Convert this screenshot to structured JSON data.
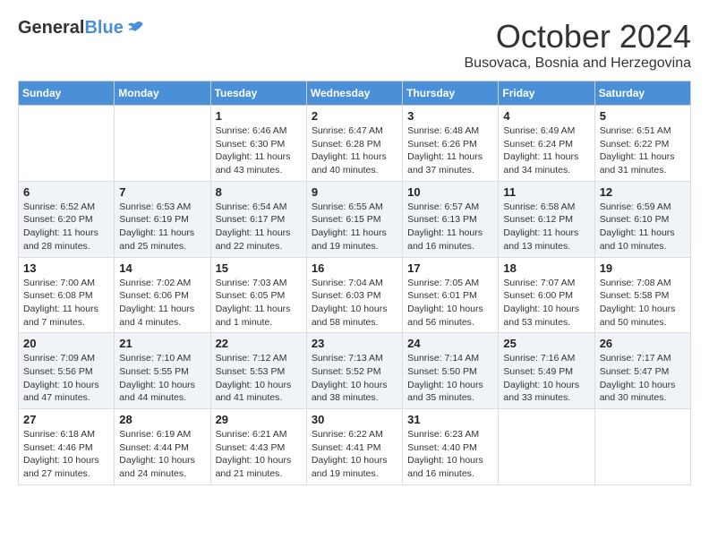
{
  "logo": {
    "general": "General",
    "blue": "Blue"
  },
  "header": {
    "month": "October 2024",
    "location": "Busovaca, Bosnia and Herzegovina"
  },
  "weekdays": [
    "Sunday",
    "Monday",
    "Tuesday",
    "Wednesday",
    "Thursday",
    "Friday",
    "Saturday"
  ],
  "weeks": [
    [
      {
        "day": "",
        "info": ""
      },
      {
        "day": "",
        "info": ""
      },
      {
        "day": "1",
        "info": "Sunrise: 6:46 AM\nSunset: 6:30 PM\nDaylight: 11 hours and 43 minutes."
      },
      {
        "day": "2",
        "info": "Sunrise: 6:47 AM\nSunset: 6:28 PM\nDaylight: 11 hours and 40 minutes."
      },
      {
        "day": "3",
        "info": "Sunrise: 6:48 AM\nSunset: 6:26 PM\nDaylight: 11 hours and 37 minutes."
      },
      {
        "day": "4",
        "info": "Sunrise: 6:49 AM\nSunset: 6:24 PM\nDaylight: 11 hours and 34 minutes."
      },
      {
        "day": "5",
        "info": "Sunrise: 6:51 AM\nSunset: 6:22 PM\nDaylight: 11 hours and 31 minutes."
      }
    ],
    [
      {
        "day": "6",
        "info": "Sunrise: 6:52 AM\nSunset: 6:20 PM\nDaylight: 11 hours and 28 minutes."
      },
      {
        "day": "7",
        "info": "Sunrise: 6:53 AM\nSunset: 6:19 PM\nDaylight: 11 hours and 25 minutes."
      },
      {
        "day": "8",
        "info": "Sunrise: 6:54 AM\nSunset: 6:17 PM\nDaylight: 11 hours and 22 minutes."
      },
      {
        "day": "9",
        "info": "Sunrise: 6:55 AM\nSunset: 6:15 PM\nDaylight: 11 hours and 19 minutes."
      },
      {
        "day": "10",
        "info": "Sunrise: 6:57 AM\nSunset: 6:13 PM\nDaylight: 11 hours and 16 minutes."
      },
      {
        "day": "11",
        "info": "Sunrise: 6:58 AM\nSunset: 6:12 PM\nDaylight: 11 hours and 13 minutes."
      },
      {
        "day": "12",
        "info": "Sunrise: 6:59 AM\nSunset: 6:10 PM\nDaylight: 11 hours and 10 minutes."
      }
    ],
    [
      {
        "day": "13",
        "info": "Sunrise: 7:00 AM\nSunset: 6:08 PM\nDaylight: 11 hours and 7 minutes."
      },
      {
        "day": "14",
        "info": "Sunrise: 7:02 AM\nSunset: 6:06 PM\nDaylight: 11 hours and 4 minutes."
      },
      {
        "day": "15",
        "info": "Sunrise: 7:03 AM\nSunset: 6:05 PM\nDaylight: 11 hours and 1 minute."
      },
      {
        "day": "16",
        "info": "Sunrise: 7:04 AM\nSunset: 6:03 PM\nDaylight: 10 hours and 58 minutes."
      },
      {
        "day": "17",
        "info": "Sunrise: 7:05 AM\nSunset: 6:01 PM\nDaylight: 10 hours and 56 minutes."
      },
      {
        "day": "18",
        "info": "Sunrise: 7:07 AM\nSunset: 6:00 PM\nDaylight: 10 hours and 53 minutes."
      },
      {
        "day": "19",
        "info": "Sunrise: 7:08 AM\nSunset: 5:58 PM\nDaylight: 10 hours and 50 minutes."
      }
    ],
    [
      {
        "day": "20",
        "info": "Sunrise: 7:09 AM\nSunset: 5:56 PM\nDaylight: 10 hours and 47 minutes."
      },
      {
        "day": "21",
        "info": "Sunrise: 7:10 AM\nSunset: 5:55 PM\nDaylight: 10 hours and 44 minutes."
      },
      {
        "day": "22",
        "info": "Sunrise: 7:12 AM\nSunset: 5:53 PM\nDaylight: 10 hours and 41 minutes."
      },
      {
        "day": "23",
        "info": "Sunrise: 7:13 AM\nSunset: 5:52 PM\nDaylight: 10 hours and 38 minutes."
      },
      {
        "day": "24",
        "info": "Sunrise: 7:14 AM\nSunset: 5:50 PM\nDaylight: 10 hours and 35 minutes."
      },
      {
        "day": "25",
        "info": "Sunrise: 7:16 AM\nSunset: 5:49 PM\nDaylight: 10 hours and 33 minutes."
      },
      {
        "day": "26",
        "info": "Sunrise: 7:17 AM\nSunset: 5:47 PM\nDaylight: 10 hours and 30 minutes."
      }
    ],
    [
      {
        "day": "27",
        "info": "Sunrise: 6:18 AM\nSunset: 4:46 PM\nDaylight: 10 hours and 27 minutes."
      },
      {
        "day": "28",
        "info": "Sunrise: 6:19 AM\nSunset: 4:44 PM\nDaylight: 10 hours and 24 minutes."
      },
      {
        "day": "29",
        "info": "Sunrise: 6:21 AM\nSunset: 4:43 PM\nDaylight: 10 hours and 21 minutes."
      },
      {
        "day": "30",
        "info": "Sunrise: 6:22 AM\nSunset: 4:41 PM\nDaylight: 10 hours and 19 minutes."
      },
      {
        "day": "31",
        "info": "Sunrise: 6:23 AM\nSunset: 4:40 PM\nDaylight: 10 hours and 16 minutes."
      },
      {
        "day": "",
        "info": ""
      },
      {
        "day": "",
        "info": ""
      }
    ]
  ]
}
